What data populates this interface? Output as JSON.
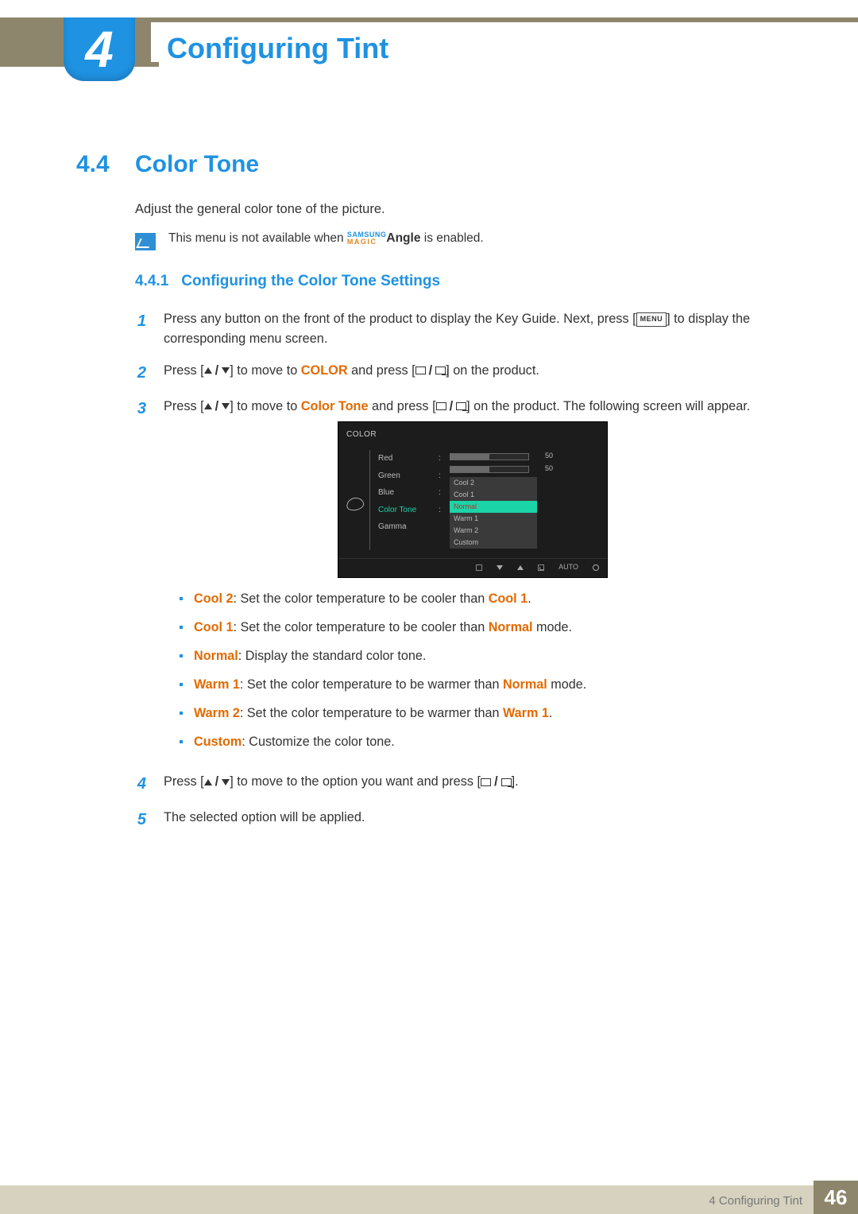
{
  "chapter_number": "4",
  "chapter_title": "Configuring Tint",
  "section": {
    "number": "4.4",
    "title": "Color Tone"
  },
  "intro": "Adjust the general color tone of the picture.",
  "note": {
    "prefix": "This menu is not available when ",
    "brand_top": "SAMSUNG",
    "brand_bottom": "MAGIC",
    "brand_suffix": "Angle",
    "suffix": " is enabled."
  },
  "subsection": {
    "number": "4.4.1",
    "title": "Configuring the Color Tone Settings"
  },
  "steps": {
    "s1_a": "Press any button on the front of the product to display the Key Guide. Next, press [",
    "s1_menu": "MENU",
    "s1_b": "] to display the corresponding menu screen.",
    "s2_a": "Press [",
    "s2_b": "] to move to ",
    "s2_kw": "COLOR",
    "s2_c": " and press [",
    "s2_d": "] on the product.",
    "s3_a": "Press [",
    "s3_b": "] to move to ",
    "s3_kw": "Color Tone",
    "s3_c": " and press [",
    "s3_d": "] on the product. The following screen will appear.",
    "s4_a": "Press [",
    "s4_b": "] to move to the option you want and press [",
    "s4_c": "].",
    "s5": "The selected option will be applied."
  },
  "osd": {
    "title": "COLOR",
    "labels": [
      "Red",
      "Green",
      "Blue",
      "Color Tone",
      "Gamma"
    ],
    "active_label_index": 3,
    "red": 50,
    "green": 50,
    "dropdown": [
      "Cool 2",
      "Cool 1",
      "Normal",
      "Warm 1",
      "Warm 2",
      "Custom"
    ],
    "dropdown_selected_index": 2,
    "footer_auto": "AUTO"
  },
  "options": [
    {
      "kw": "Cool 2",
      "mid": ": Set the color temperature to be cooler than ",
      "kw2": "Cool 1",
      "tail": "."
    },
    {
      "kw": "Cool 1",
      "mid": ": Set the color temperature to be cooler than ",
      "kw2": "Normal",
      "tail": " mode."
    },
    {
      "kw": "Normal",
      "mid": ": Display the standard color tone.",
      "kw2": "",
      "tail": ""
    },
    {
      "kw": "Warm 1",
      "mid": ": Set the color temperature to be warmer than ",
      "kw2": "Normal",
      "tail": " mode."
    },
    {
      "kw": "Warm 2",
      "mid": ": Set the color temperature to be warmer than ",
      "kw2": "Warm 1",
      "tail": "."
    },
    {
      "kw": "Custom",
      "mid": ": Customize the color tone.",
      "kw2": "",
      "tail": ""
    }
  ],
  "footer": {
    "label": "4 Configuring Tint",
    "page": "46"
  }
}
